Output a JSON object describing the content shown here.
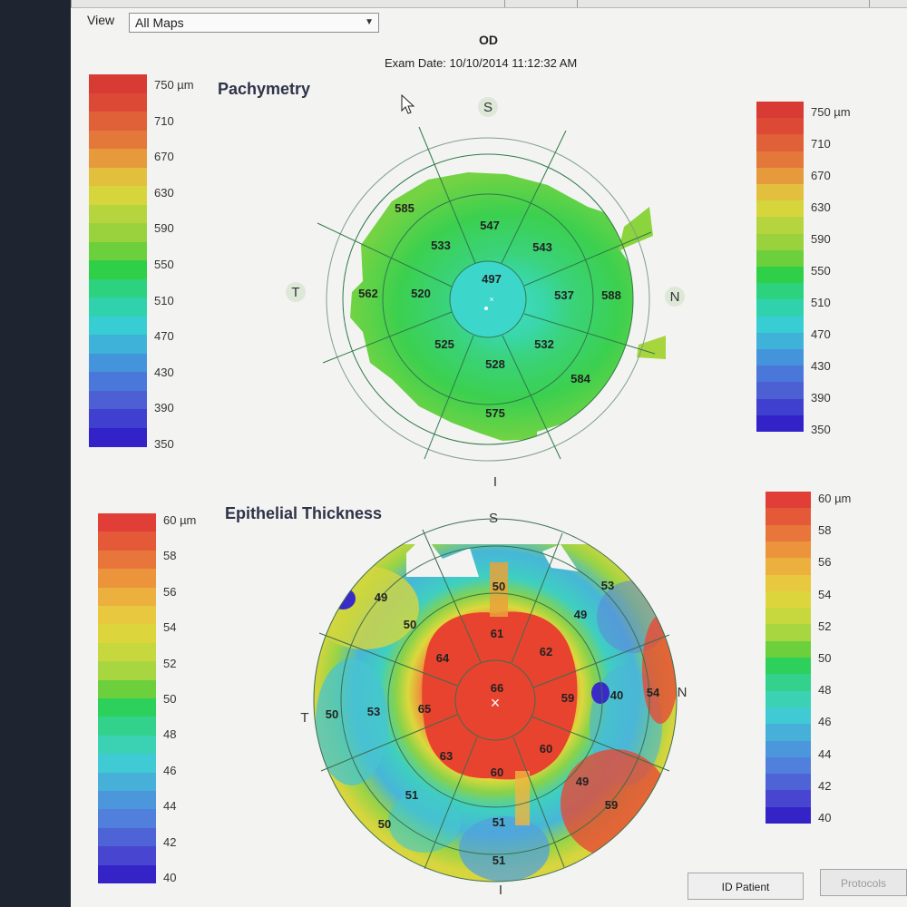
{
  "view": {
    "label": "View",
    "selected": "All Maps"
  },
  "eye": "OD",
  "exam_date": "Exam Date: 10/10/2014 11:12:32 AM",
  "pachymetry": {
    "title": "Pachymetry",
    "directions": {
      "superior": "S",
      "inferior": "I",
      "temporal": "T",
      "nasal": "N"
    },
    "scale_labels": [
      "750 µm",
      "710",
      "670",
      "630",
      "590",
      "550",
      "510",
      "470",
      "430",
      "390",
      "350"
    ],
    "center": "497",
    "ring2": [
      "547",
      "543",
      "537",
      "532",
      "528",
      "525",
      "520",
      "533"
    ],
    "ring3": [
      "585",
      "562",
      "588",
      "584",
      "575"
    ]
  },
  "epithelial": {
    "title": "Epithelial Thickness",
    "directions": {
      "superior": "S",
      "inferior": "I",
      "temporal": "T",
      "nasal": "N"
    },
    "scale_labels": [
      "60 µm",
      "58",
      "56",
      "54",
      "52",
      "50",
      "48",
      "46",
      "44",
      "42",
      "40"
    ],
    "center": "66",
    "ring2": [
      "61",
      "62",
      "59",
      "60",
      "60",
      "63",
      "65",
      "64"
    ],
    "ring3": [
      "50",
      "49",
      "40",
      "49",
      "51",
      "51",
      "53",
      "50"
    ],
    "ring4": [
      "53",
      "54",
      "59",
      "51",
      "50",
      "50",
      "49"
    ]
  },
  "colors": {
    "pachy_scale": [
      "#d83a34",
      "#dc4a36",
      "#e06038",
      "#e4783a",
      "#e69a3c",
      "#e2c03e",
      "#d6d63c",
      "#b6d43e",
      "#9ad23e",
      "#6ccf3c",
      "#2fcf48",
      "#2dd27e",
      "#30d2ae",
      "#38cdd2",
      "#3eb2d8",
      "#4494dc",
      "#4a78da",
      "#4c60d4",
      "#4040d0",
      "#3222c8"
    ],
    "epi_scale": [
      "#e03e36",
      "#e45a38",
      "#e8763a",
      "#eb943c",
      "#ecb03e",
      "#e8c83e",
      "#dcd63c",
      "#c6d83e",
      "#a8d640",
      "#6ccf3c",
      "#2dd05a",
      "#32d28c",
      "#3bd2b4",
      "#40cbd4",
      "#46b0d8",
      "#4c96dc",
      "#5080dc",
      "#4e64d6",
      "#4846d0",
      "#3424c8"
    ]
  },
  "buttons": {
    "id_patient": "ID Patient",
    "protocols": "Protocols"
  }
}
